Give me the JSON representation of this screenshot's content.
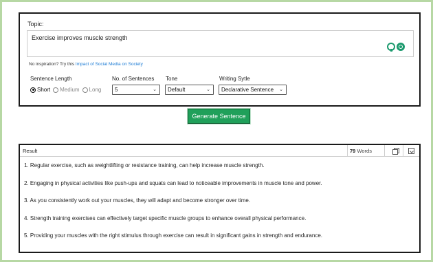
{
  "topic": {
    "label": "Topic:",
    "value": "Exercise improves muscle strength",
    "inspiration_prefix": "No inspiration? Try this ",
    "inspiration_link": "Impact of Social Media on Society"
  },
  "options": {
    "sentence_length_label": "Sentence Length",
    "length_choices": [
      "Short",
      "Medium",
      "Long"
    ],
    "length_selected": "Short",
    "num_sentences_label": "No. of Sentences",
    "num_sentences_value": "5",
    "tone_label": "Tone",
    "tone_value": "Default",
    "style_label": "Writing Sytle",
    "style_value": "Declarative Sentence"
  },
  "generate_button": "Generate Sentence",
  "result": {
    "title": "Result",
    "word_count": "79",
    "word_label": "Words",
    "sentences": [
      "1. Regular exercise, such as weightlifting or resistance training, can help increase muscle strength.",
      "2. Engaging in physical activities like push-ups and squats can lead to noticeable improvements in muscle tone and power.",
      "3. As you consistently work out your muscles, they will adapt and become stronger over time.",
      "4. Strength training exercises can effectively target specific muscle groups to enhance overall physical performance.",
      "5. Providing your muscles with the right stimulus through exercise can result in significant gains in strength and endurance."
    ]
  },
  "colors": {
    "accent_green": "#20a05a",
    "frame_green": "#b7d8a4",
    "link_blue": "#1a7ad4"
  }
}
